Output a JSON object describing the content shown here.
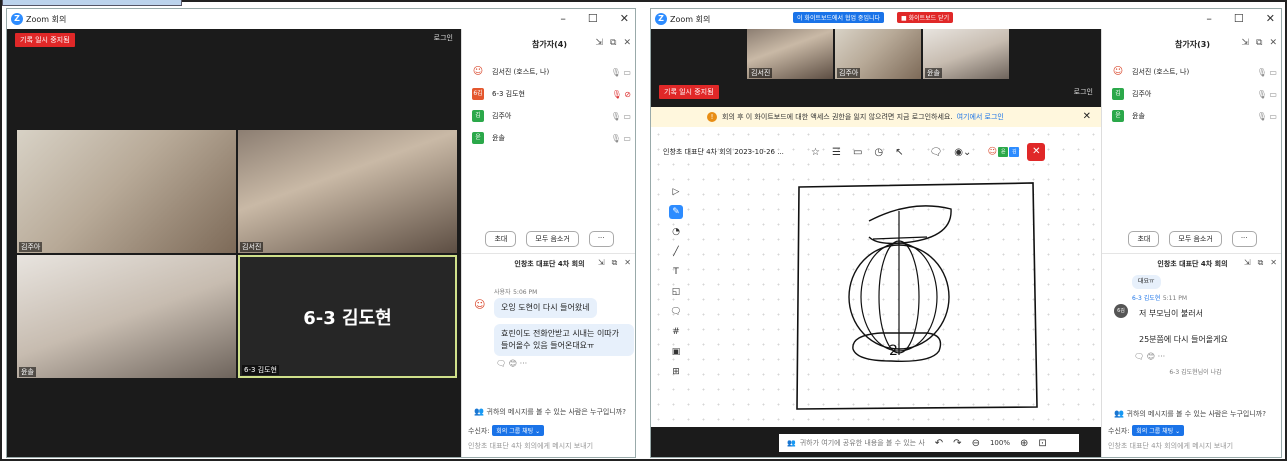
{
  "windows": [
    {
      "title": "Zoom 회의",
      "recording": "기록 일시 중지됨",
      "login": "로그인",
      "tiles": [
        {
          "name": "김주아"
        },
        {
          "name": "김서진"
        },
        {
          "name": "윤솔"
        },
        {
          "name": "6-3 김도현",
          "big_label": "6-3 김도현"
        }
      ],
      "participants_panel": {
        "title": "참가자(4)",
        "items": [
          {
            "avatar": "",
            "avatar_color": "#d9472b",
            "name": "김서진 (호스트, 나)",
            "muted": false
          },
          {
            "avatar": "6김",
            "avatar_color": "#e4572e",
            "name": "6-3 김도현",
            "muted": true
          },
          {
            "avatar": "김",
            "avatar_color": "#2ba84a",
            "name": "김주아",
            "muted": false
          },
          {
            "avatar": "윤",
            "avatar_color": "#2ba84a",
            "name": "윤솔",
            "muted": false
          }
        ],
        "invite": "초대",
        "mute_all": "모두 음소거",
        "more": "···"
      },
      "chat": {
        "title": "인창초 대표단 4차 회의",
        "sender": "사용자",
        "time": "5:06 PM",
        "msg1": "오잉 도현이 다시 들어왔네",
        "msg2": "효린이도 전화안받고 시내는 이따가 들어올수 있음 들어온대요ㅠ",
        "reacts": "🗨 😊 ···",
        "who_can_see": "귀하의 메시지를 볼 수 있는 사람은 누구입니까?",
        "to_label": "수신자:",
        "to_value": "회의 그룹 채팅 ⌄",
        "placeholder": "인창초 대표단 4차 회의에게 메시지 보내기"
      }
    },
    {
      "title": "Zoom 회의",
      "banner_sharing": "이 화이트보드에서 협업 중입니다",
      "banner_close": "■ 화이트보드 닫기",
      "recording": "기록 일시 중지됨",
      "login": "로그인",
      "thumbs": [
        {
          "name": "김서진"
        },
        {
          "name": "김주아"
        },
        {
          "name": "윤솔"
        }
      ],
      "warning": {
        "text": "회의 후 이 화이트보드에 대한 액세스 권한을 잃지 않으려면 지금 로그인하세요.",
        "link": "여기에서 로그인"
      },
      "whiteboard": {
        "title": "인창초 대표단 4차 회의 2023-10-26 ...",
        "drawing_label": "2",
        "bottom_hint": "귀하가 여기에 공유한 내용을 볼 수 있는 사",
        "zoom": "100%"
      },
      "participants_panel": {
        "title": "참가자(3)",
        "items": [
          {
            "avatar": "",
            "avatar_color": "#d9472b",
            "name": "김서진 (호스트, 나)"
          },
          {
            "avatar": "김",
            "avatar_color": "#2ba84a",
            "name": "김주아"
          },
          {
            "avatar": "윤",
            "avatar_color": "#2ba84a",
            "name": "윤솔"
          }
        ],
        "invite": "초대",
        "mute_all": "모두 음소거",
        "more": "···"
      },
      "chat": {
        "title": "인창초 대표단 4차 회의",
        "prev": "대요ㅠ",
        "sender": "6-3 김도현",
        "time": "5:11 PM",
        "msg1": "저 부모님이 불러서",
        "msg2": "25분쯤에 다시 들어올게요",
        "reacts": "🗨 😊 ···",
        "left_notice": "6-3 김도현님이 나감",
        "who_can_see": "귀하의 메시지를 볼 수 있는 사람은 누구입니까?",
        "to_label": "수신자:",
        "to_value": "회의 그룹 채팅 ⌄",
        "placeholder": "인창초 대표단 4차 회의에게 메시지 보내기"
      }
    }
  ]
}
